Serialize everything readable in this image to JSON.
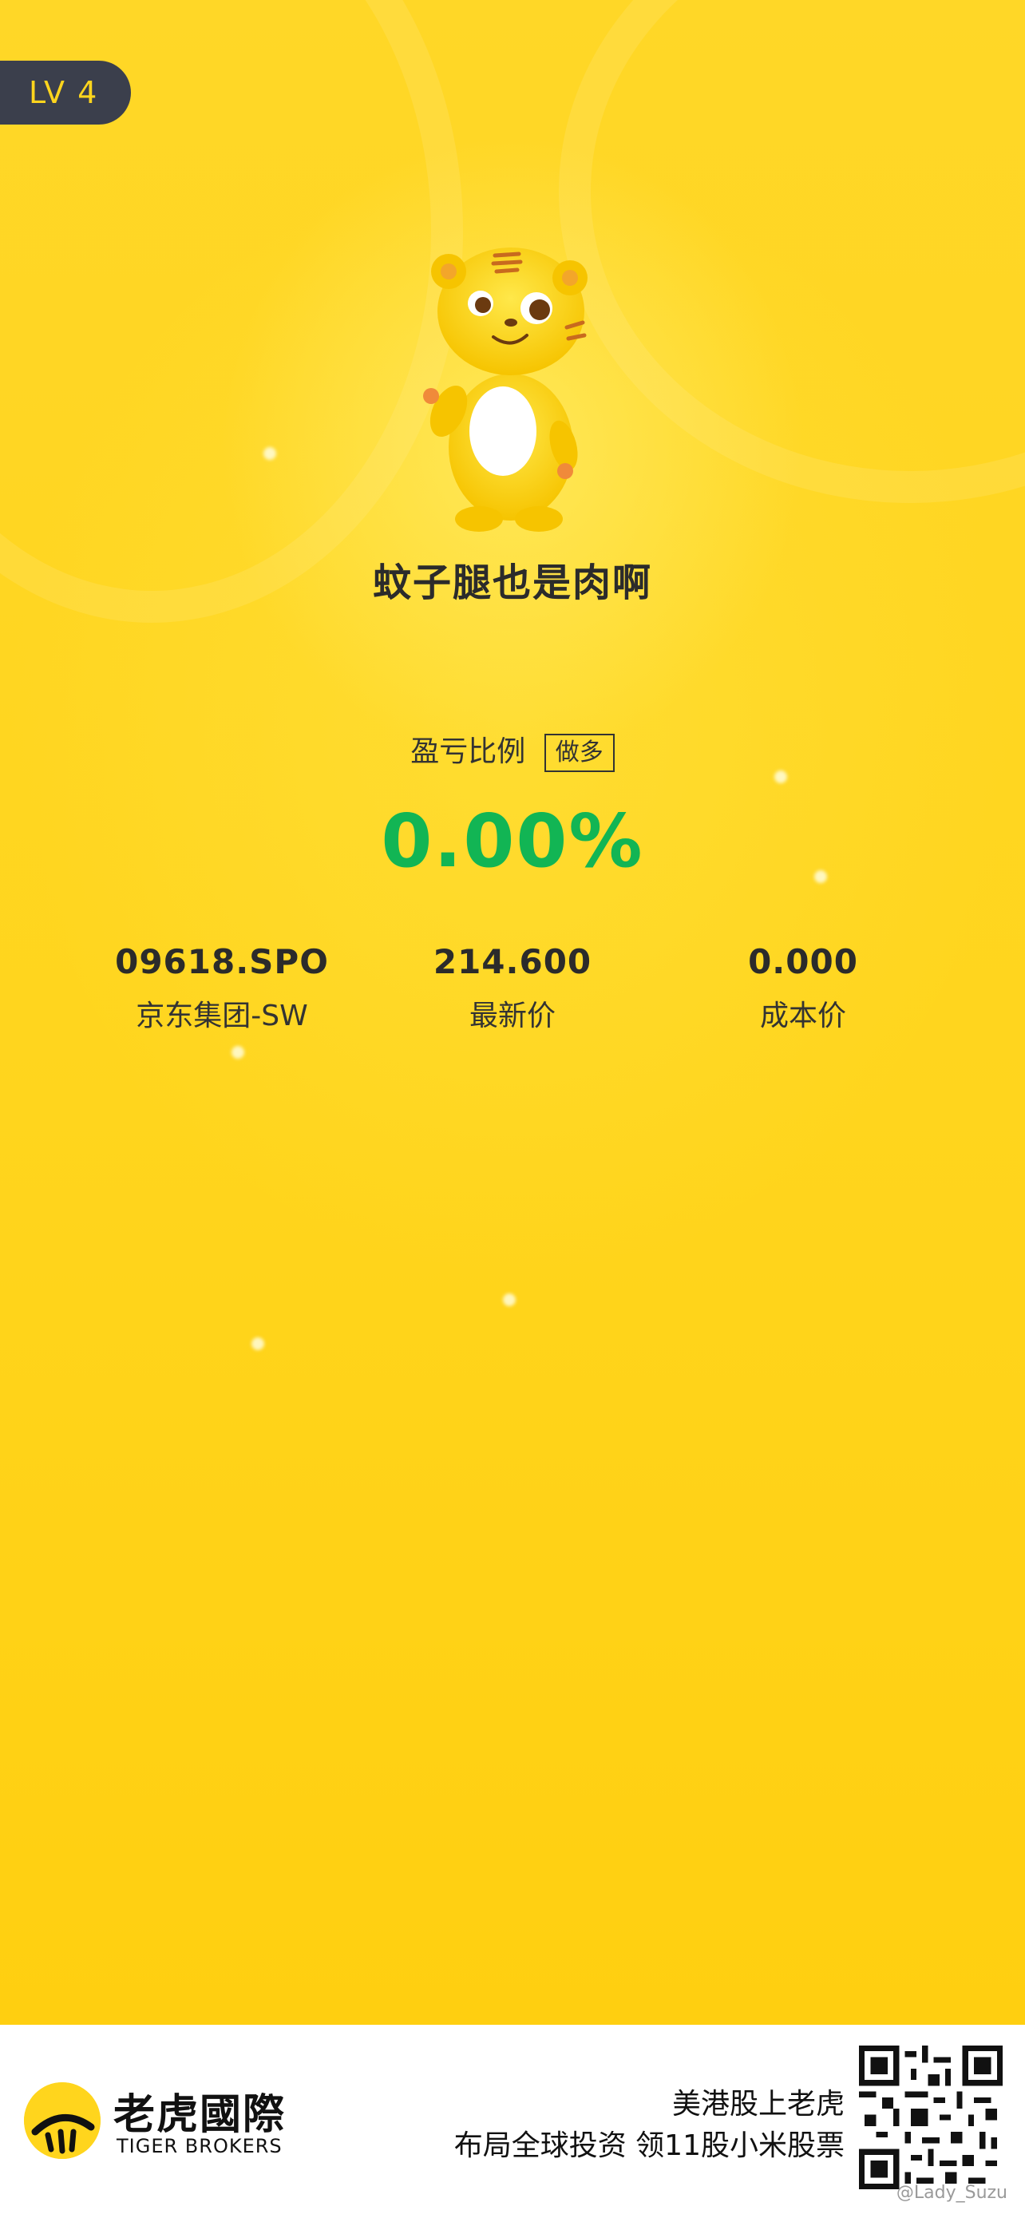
{
  "level_badge": "LV 4",
  "nickname": "蚊子腿也是肉啊",
  "profit_ratio": {
    "label": "盈亏比例",
    "direction_tag": "做多",
    "value": "0.00%",
    "value_color": "#12b554"
  },
  "stats": [
    {
      "value": "09618.SPO",
      "label": "京东集团-SW"
    },
    {
      "value": "214.600",
      "label": "最新价"
    },
    {
      "value": "0.000",
      "label": "成本价"
    }
  ],
  "footer": {
    "brand_cn": "老虎國際",
    "brand_en": "TIGER BROKERS",
    "slogan_line1": "美港股上老虎",
    "slogan_line2": "布局全球投资 领11股小米股票",
    "watermark": "@Lady_Suzu"
  },
  "icons": {
    "mascot": "tiger-mascot-icon",
    "logo": "tiger-logo-icon",
    "qr": "qr-code"
  },
  "colors": {
    "background": "#ffd51d",
    "badge": "#3b3f4c",
    "gain": "#12b554"
  }
}
